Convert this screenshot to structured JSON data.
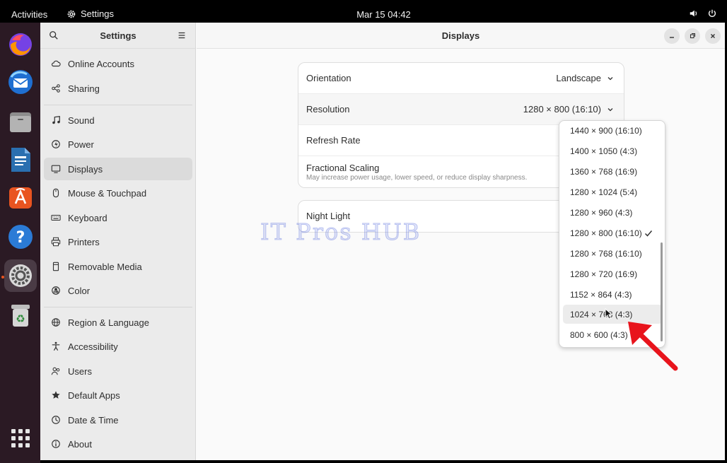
{
  "topbar": {
    "activities": "Activities",
    "app_name": "Settings",
    "clock": "Mar 15  04:42",
    "icons": [
      "gear-icon",
      "volume-icon",
      "power-icon"
    ]
  },
  "dock": {
    "apps": [
      "firefox-icon",
      "thunderbird-icon",
      "files-icon",
      "writer-icon",
      "app-center-icon",
      "help-icon",
      "settings-icon",
      "trash-icon",
      "show-apps-icon"
    ],
    "active": "settings-icon"
  },
  "sidebar": {
    "title": "Settings",
    "items": [
      {
        "label": "Online Accounts",
        "icon": "cloud-icon"
      },
      {
        "label": "Sharing",
        "icon": "share-icon"
      },
      {
        "label": "Sound",
        "icon": "music-note-icon"
      },
      {
        "label": "Power",
        "icon": "power-icon"
      },
      {
        "label": "Displays",
        "icon": "monitor-icon",
        "selected": true
      },
      {
        "label": "Mouse & Touchpad",
        "icon": "mouse-icon"
      },
      {
        "label": "Keyboard",
        "icon": "keyboard-icon"
      },
      {
        "label": "Printers",
        "icon": "printer-icon"
      },
      {
        "label": "Removable Media",
        "icon": "usb-drive-icon"
      },
      {
        "label": "Color",
        "icon": "color-icon"
      },
      {
        "label": "Region & Language",
        "icon": "globe-icon"
      },
      {
        "label": "Accessibility",
        "icon": "accessibility-icon"
      },
      {
        "label": "Users",
        "icon": "users-icon"
      },
      {
        "label": "Default Apps",
        "icon": "star-icon"
      },
      {
        "label": "Date & Time",
        "icon": "clock-icon"
      },
      {
        "label": "About",
        "icon": "info-icon"
      }
    ]
  },
  "main": {
    "title": "Displays",
    "orientation": {
      "label": "Orientation",
      "value": "Landscape"
    },
    "resolution": {
      "label": "Resolution",
      "value": "1280 × 800 (16:10)"
    },
    "refresh_rate": {
      "label": "Refresh Rate"
    },
    "fractional_scaling": {
      "label": "Fractional Scaling",
      "sub": "May increase power usage, lower speed, or reduce display sharpness."
    },
    "night_light": {
      "label": "Night Light"
    }
  },
  "resolution_options": [
    "1440 × 900 (16:10)",
    "1400 × 1050 (4:3)",
    "1360 × 768 (16:9)",
    "1280 × 1024 (5:4)",
    "1280 × 960 (4:3)",
    "1280 × 800 (16:10)",
    "1280 × 768 (16:10)",
    "1280 × 720 (16:9)",
    "1152 × 864 (4:3)",
    "1024 × 768 (4:3)",
    "800 × 600 (4:3)"
  ],
  "selected_resolution": "1280 × 800 (16:10)",
  "hovered_resolution": "1024 × 768 (4:3)",
  "watermark": "IT Pros HUB",
  "colors": {
    "accent": "#e95420",
    "arrow": "#e8141c",
    "dock_bg": "#2b1a24"
  }
}
